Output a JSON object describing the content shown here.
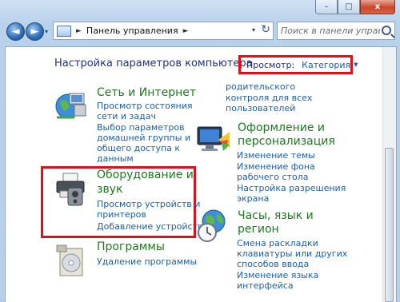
{
  "window": {
    "close_glyph": "x",
    "minimize_glyph": "–",
    "maximize_glyph": "□"
  },
  "nav": {
    "back_glyph": "◄",
    "forward_glyph": "►",
    "history_glyph": "▾",
    "breadcrumb": "Панель управления",
    "breadcrumb_separator": "►",
    "refresh_glyph": "↻",
    "search_placeholder": "Поиск в панели управле..."
  },
  "header": {
    "title": "Настройка параметров компьютера",
    "view_label": "Просмотр:",
    "view_value": "Категория",
    "view_arrow": "▼"
  },
  "categories": {
    "network": {
      "title": "Сеть и Интернет",
      "links": [
        "Просмотр состояния",
        "сети и задач",
        "Выбор параметров",
        "домашней группы и",
        "общего доступа к",
        "данным"
      ],
      "icon": "network-globe-icon"
    },
    "top_continuation": {
      "lines": [
        "родительского",
        "контроля для всех",
        "пользователей"
      ]
    },
    "appearance": {
      "title_lines": [
        "Оформление и",
        "персонализация"
      ],
      "links": [
        "Изменение темы",
        "Изменение фона",
        "рабочего стола",
        "Настройка разрешения",
        "экрана"
      ],
      "icon": "monitor-paint-icon"
    },
    "hardware": {
      "title_lines": [
        "Оборудование и",
        "звук"
      ],
      "links": [
        "Просмотр устройств и",
        "принтеров",
        "Добавление устройства"
      ],
      "icon": "printer-icon"
    },
    "clock": {
      "title_lines": [
        "Часы, язык и",
        "регион"
      ],
      "links": [
        "Смена раскладки",
        "клавиатуры или других",
        "способов ввода",
        "Изменение языка",
        "интерфейса"
      ],
      "icon": "globe-clock-icon"
    },
    "programs": {
      "title": "Программы",
      "links": [
        "Удаление программы"
      ],
      "icon": "programs-disk-icon"
    }
  },
  "colors": {
    "highlight": "#e0101a",
    "link": "#1a5fb4",
    "category": "#1d7a1f",
    "heading": "#1e3287"
  }
}
